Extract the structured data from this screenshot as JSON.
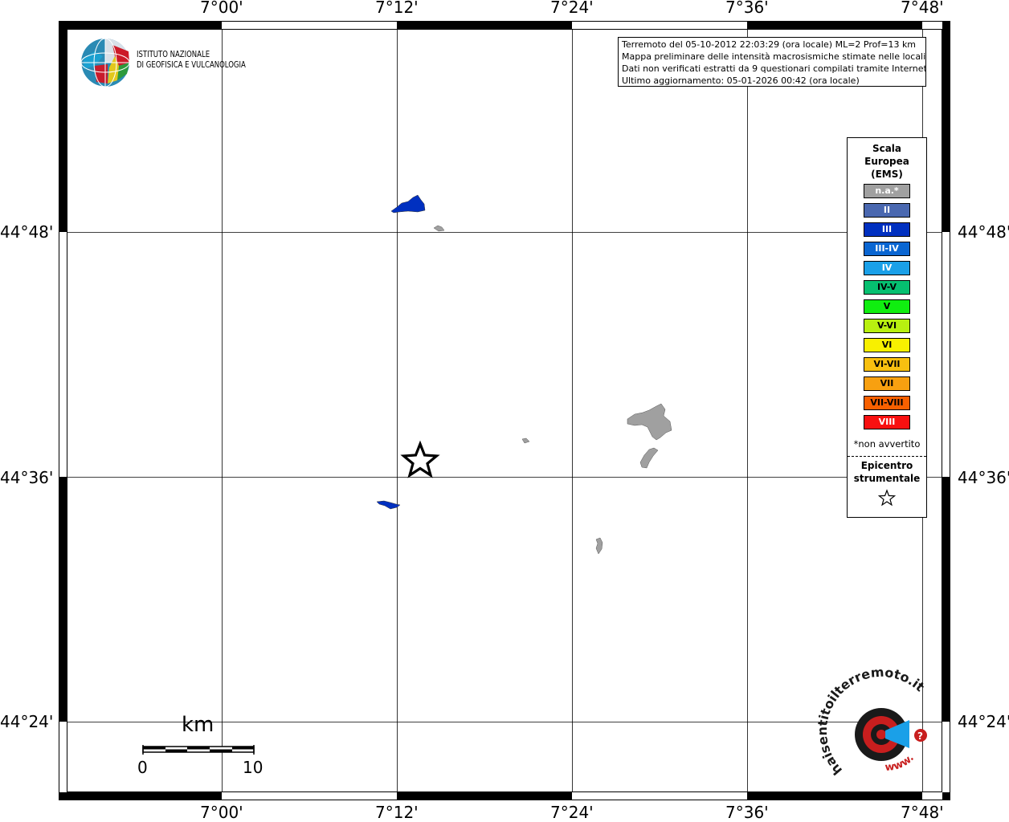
{
  "map": {
    "lon_labels": [
      "7°00'",
      "7°12'",
      "7°24'",
      "7°36'",
      "7°48'"
    ],
    "lat_labels": [
      "44°48'",
      "44°36'",
      "44°24'"
    ]
  },
  "logo": {
    "line1": "ISTITUTO NAZIONALE",
    "line2": "DI GEOFISICA E VULCANOLOGIA"
  },
  "info": {
    "line1": "Terremoto del 05-10-2012 22:03:29 (ora locale) ML=2 Prof=13 km",
    "line2": "Mappa preliminare delle intensità macrosismiche stimate nelle località",
    "line3": "Dati non verificati estratti da 9 questionari compilati tramite Internet.",
    "line4": "Ultimo aggiornamento: 05-01-2026 00:42 (ora locale)"
  },
  "legend": {
    "title": [
      "Scala",
      "Europea",
      "(EMS)"
    ],
    "items": [
      {
        "label": "n.a.*",
        "color": "#a0a0a0",
        "text": "#ffffff"
      },
      {
        "label": "II",
        "color": "#4a68b0",
        "text": "#ffffff"
      },
      {
        "label": "III",
        "color": "#0030c0",
        "text": "#ffffff"
      },
      {
        "label": "III-IV",
        "color": "#0a66d2",
        "text": "#ffffff"
      },
      {
        "label": "IV",
        "color": "#1aa0e8",
        "text": "#ffffff"
      },
      {
        "label": "IV-V",
        "color": "#06c070",
        "text": "#000000"
      },
      {
        "label": "V",
        "color": "#10ee10",
        "text": "#000000"
      },
      {
        "label": "V-VI",
        "color": "#b8f010",
        "text": "#000000"
      },
      {
        "label": "VI",
        "color": "#f8f000",
        "text": "#000000"
      },
      {
        "label": "VI-VII",
        "color": "#f8c010",
        "text": "#000000"
      },
      {
        "label": "VII",
        "color": "#f8a010",
        "text": "#000000"
      },
      {
        "label": "VII-VIII",
        "color": "#f86000",
        "text": "#000000"
      },
      {
        "label": "VIII",
        "color": "#f81010",
        "text": "#ffffff"
      }
    ],
    "note": "*non avvertito",
    "epicenter": [
      "Epicentro",
      "strumentale"
    ]
  },
  "scale_bar": {
    "unit": "km",
    "min": "0",
    "max": "10"
  },
  "watermark": {
    "text": "haisentitoilterremoto.it",
    "url": "www."
  }
}
